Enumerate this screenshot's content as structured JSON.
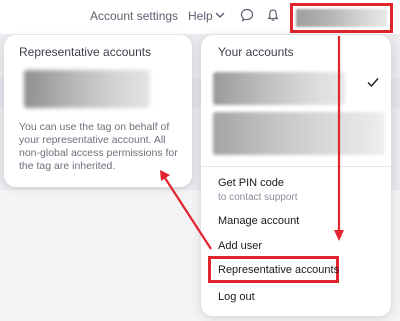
{
  "header": {
    "account_settings": "Account settings",
    "help": "Help"
  },
  "icons": {
    "help_chevron": "chevron-down-icon",
    "chat": "chat-icon",
    "bell": "bell-icon",
    "check": "check-icon"
  },
  "representative_panel": {
    "title": "Representative accounts",
    "description": "You can use the tag on behalf of your representative account. All non-global access permissions for the tag are inherited."
  },
  "accounts_menu": {
    "title": "Your accounts",
    "items": [
      {
        "label": "Get PIN code",
        "sub": "to contact support"
      },
      {
        "label": "Manage account"
      },
      {
        "label": "Add user"
      },
      {
        "label": "Representative accounts"
      },
      {
        "label": "Log out"
      }
    ]
  },
  "colors": {
    "highlight": "#e2242c",
    "text_muted": "#6a707b",
    "background": "#ebebef"
  }
}
